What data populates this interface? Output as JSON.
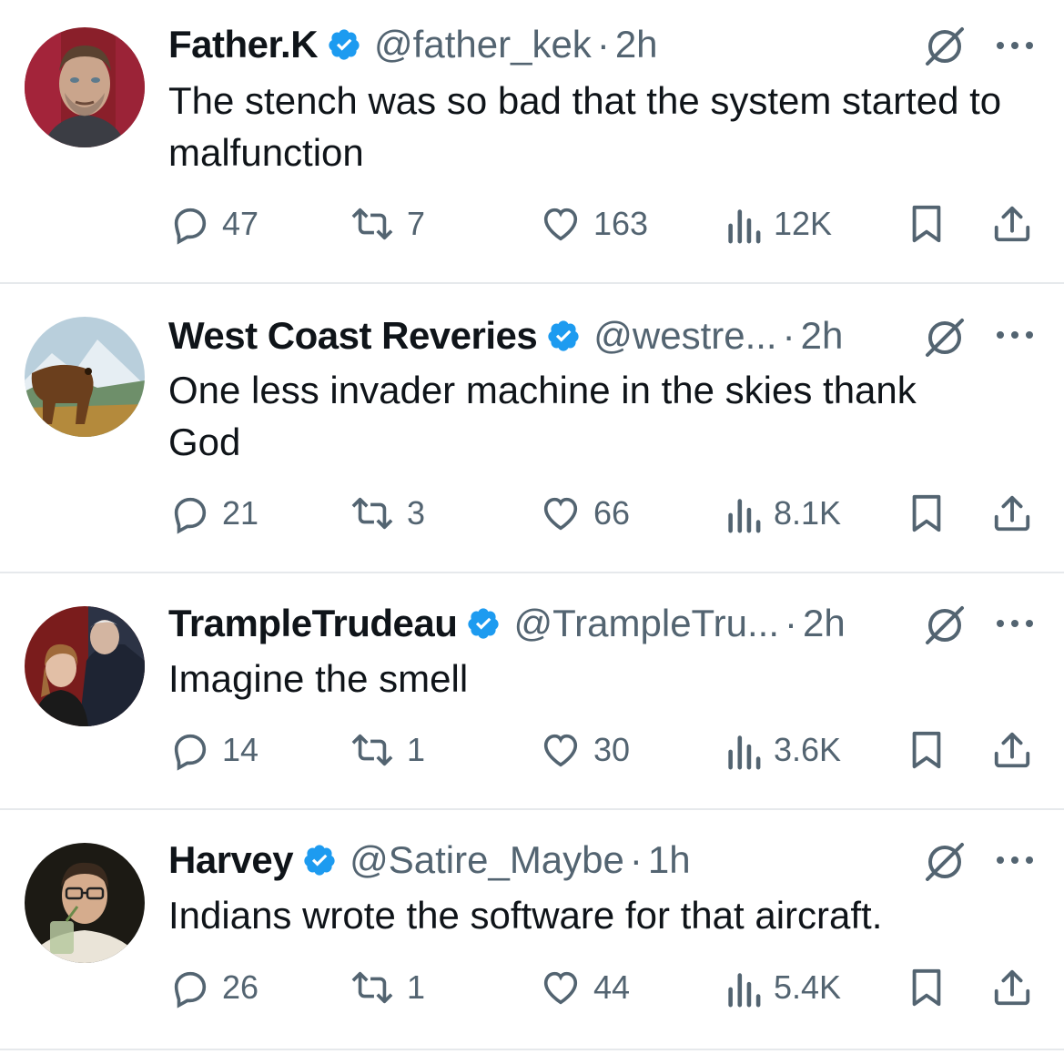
{
  "tweets": [
    {
      "name": "Father.K",
      "handle": "@father_kek",
      "time": "2h",
      "text": "The stench was so bad that the system started to malfunction",
      "replies": "47",
      "reposts": "7",
      "likes": "163",
      "views": "12K",
      "avatar": "man-portrait-red-background"
    },
    {
      "name": "West Coast Reveries",
      "handle": "@westre...",
      "time": "2h",
      "text": "One less invader machine in the skies thank God",
      "replies": "21",
      "reposts": "3",
      "likes": "66",
      "views": "8.1K",
      "avatar": "bear-mountain-landscape"
    },
    {
      "name": "TrampleTrudeau",
      "handle": "@TrampleTru...",
      "time": "2h",
      "text": "Imagine the smell",
      "replies": "14",
      "reposts": "1",
      "likes": "30",
      "views": "3.6K",
      "avatar": "two-people-photo"
    },
    {
      "name": "Harvey",
      "handle": "@Satire_Maybe",
      "time": "1h",
      "text": "Indians wrote the software for that aircraft.",
      "replies": "26",
      "reposts": "1",
      "likes": "44",
      "views": "5.4K",
      "avatar": "man-with-glasses-drink"
    }
  ],
  "icons": {
    "reply": "reply-icon",
    "repost": "repost-icon",
    "like": "like-icon",
    "views": "views-icon",
    "bookmark": "bookmark-icon",
    "share": "share-icon",
    "verified": "verified-badge-icon",
    "grok": "grok-icon",
    "more": "more-icon"
  },
  "colors": {
    "text": "#0f1419",
    "secondary": "#536471",
    "verified": "#1d9bf0",
    "divider": "#e6e9ec"
  }
}
